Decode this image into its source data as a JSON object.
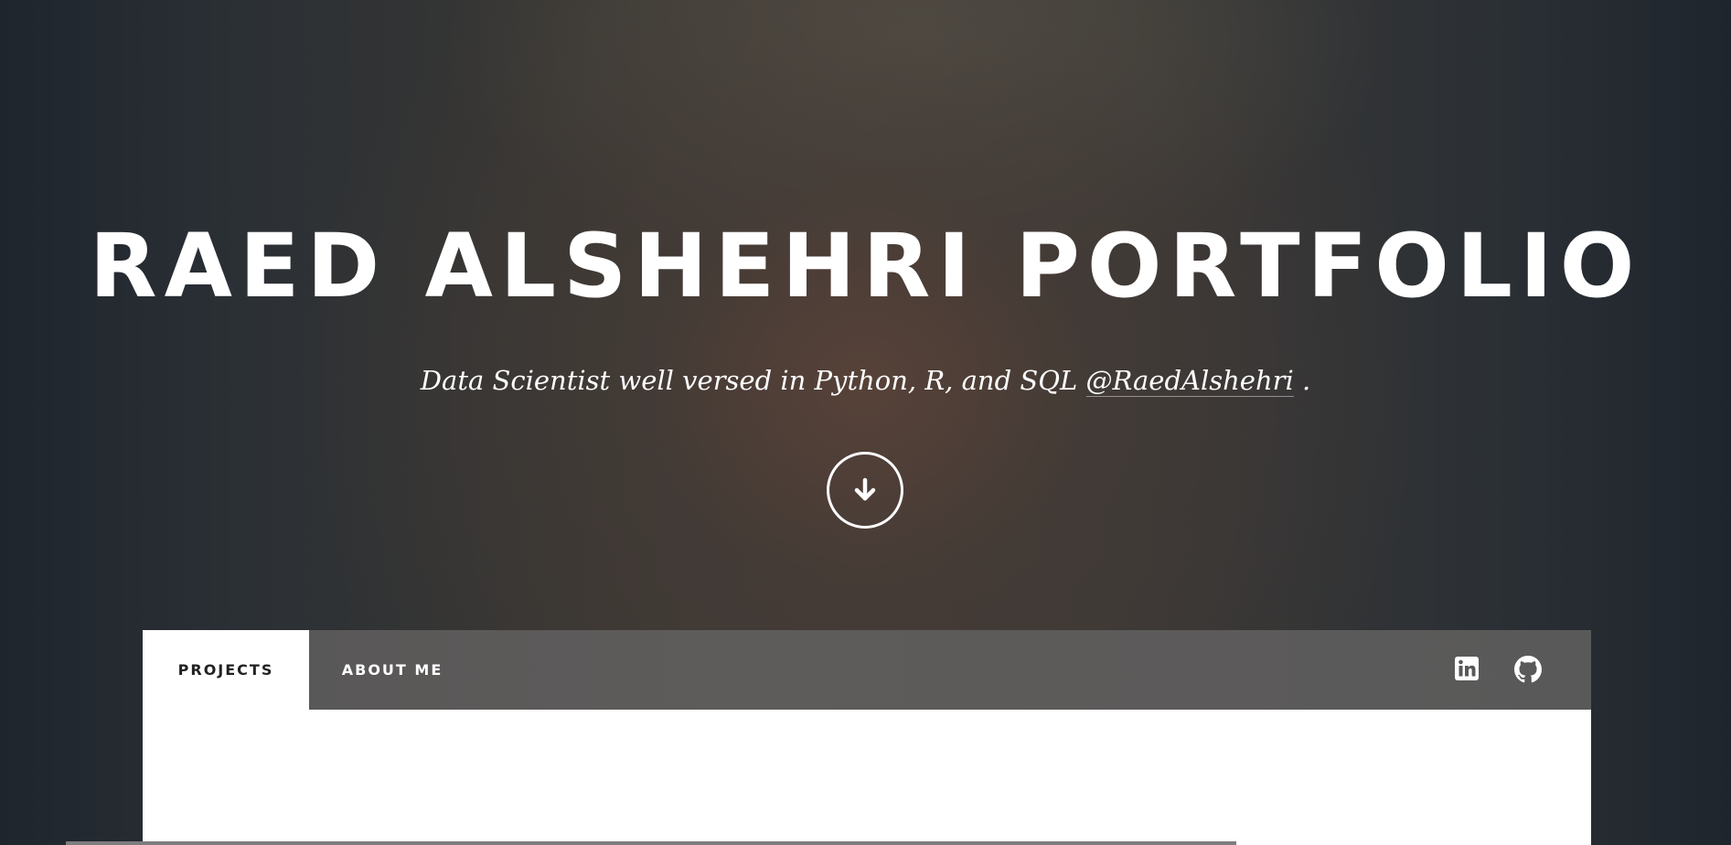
{
  "hero": {
    "title": "RAED ALSHEHRI PORTFOLIO",
    "subtitle_text": "Data Scientist well versed in Python, R, and SQL ",
    "subtitle_link": "@RaedAlshehri",
    "subtitle_end": " ."
  },
  "scroll_button": {
    "icon": "arrow-down-icon"
  },
  "nav": {
    "tabs": [
      {
        "label": "PROJECTS",
        "active": true
      },
      {
        "label": "ABOUT ME",
        "active": false
      }
    ],
    "social": [
      {
        "icon": "linkedin-icon"
      },
      {
        "icon": "github-icon"
      }
    ]
  },
  "colors": {
    "text": "#ffffff",
    "nav_bg": "#5a5959",
    "active_tab_bg": "#ffffff",
    "active_tab_text": "#222222"
  }
}
